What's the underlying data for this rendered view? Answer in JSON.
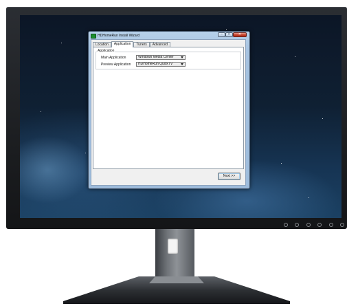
{
  "window": {
    "title": "HDHomeRun Install Wizard",
    "controls": {
      "minimize": "–",
      "maximize": "□",
      "close": "✕"
    }
  },
  "tabs": [
    {
      "label": "Location",
      "active": false
    },
    {
      "label": "Application",
      "active": true
    },
    {
      "label": "Tuners",
      "active": false
    },
    {
      "label": "Advanced",
      "active": false
    }
  ],
  "application_group": {
    "label": "Application",
    "main_application": {
      "label": "Main Application",
      "value": "Windows Media Center"
    },
    "preview_application": {
      "label": "Preview Application",
      "value": "HDHomeRun QuickTV"
    }
  },
  "buttons": {
    "next": "Next >>"
  },
  "icons": {
    "app": "hdhomerun-app-icon",
    "dropdown": "chevron-down-icon"
  },
  "colors": {
    "titlebar": "#a6c3e1",
    "close_button": "#c8452f",
    "app_icon": "#1c8f2e",
    "desktop": "#163453"
  }
}
